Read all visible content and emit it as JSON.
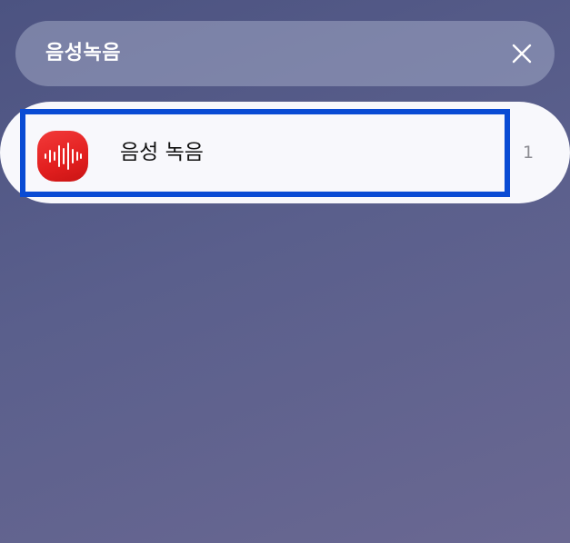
{
  "search": {
    "query": "음성녹음"
  },
  "results": [
    {
      "app_name": "음성 녹음",
      "icon": "voice-recorder-icon",
      "count": "1"
    }
  ],
  "colors": {
    "highlight_border": "#0a4bd4",
    "app_icon_red": "#e21f1f"
  }
}
